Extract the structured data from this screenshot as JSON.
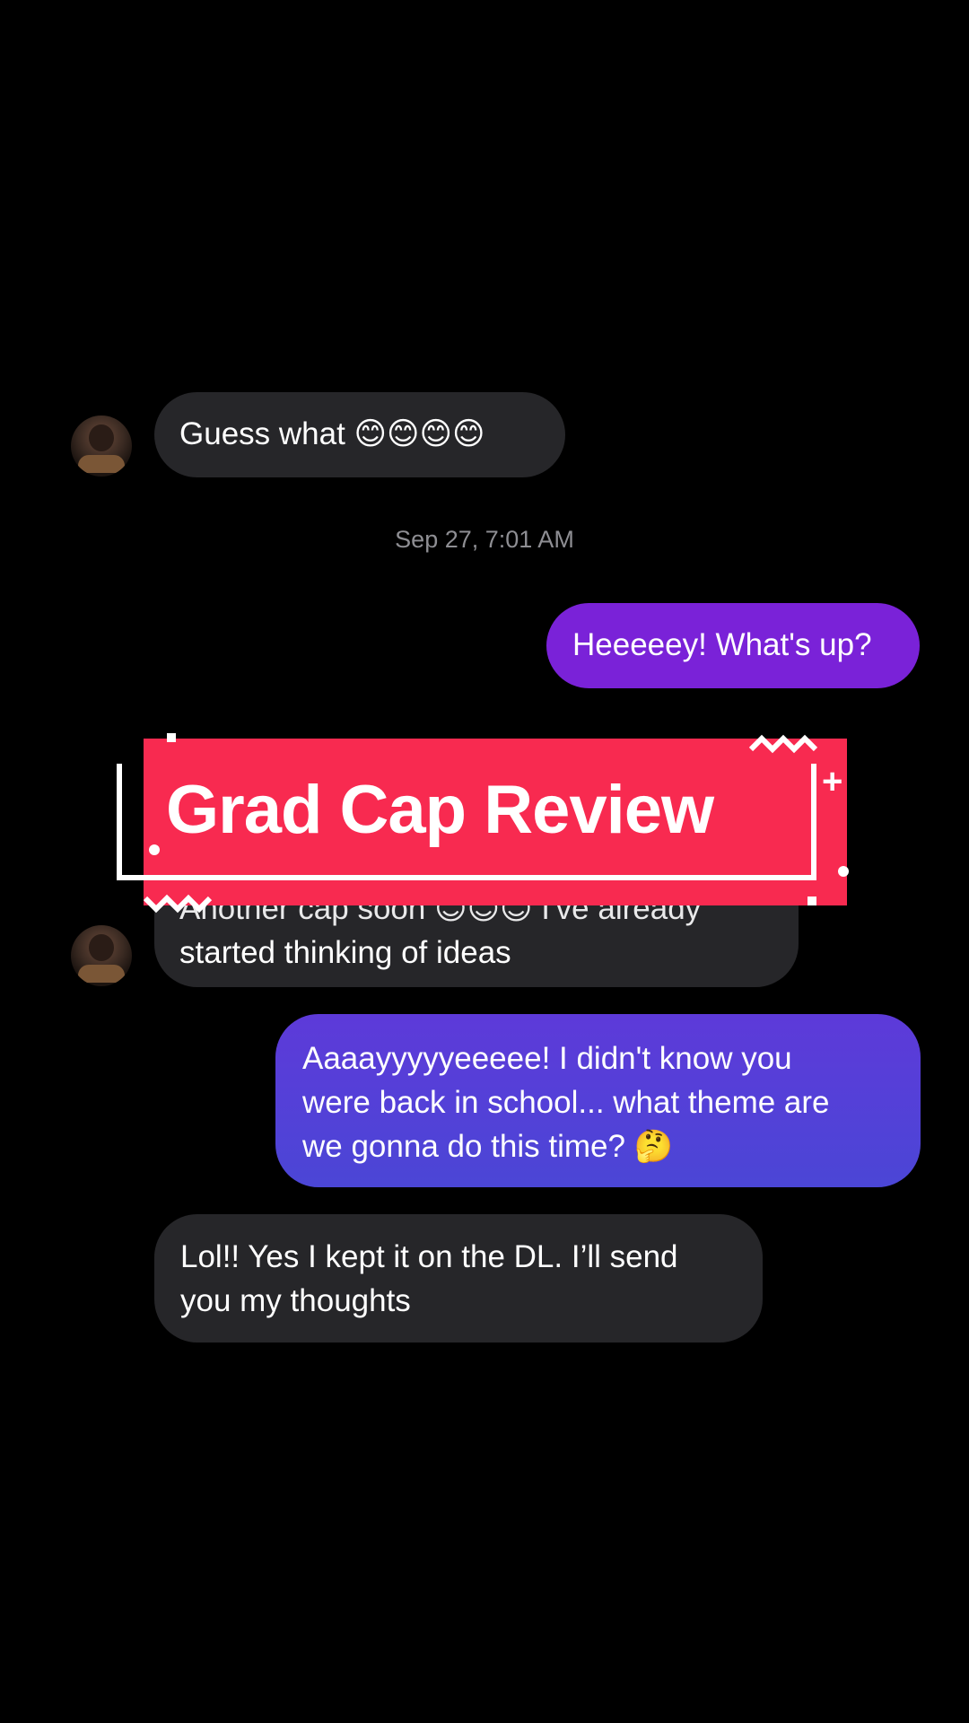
{
  "messages": [
    {
      "from": "them",
      "text": "Guess what 😊😊😊😊"
    },
    {
      "from": "meta",
      "text": "Sep 27, 7:01 AM"
    },
    {
      "from": "me",
      "text": "Heeeeey! What's up?"
    },
    {
      "from": "them",
      "lines": [
        "Another cap soon 😊😊😊 I've already",
        "started thinking of ideas"
      ]
    },
    {
      "from": "me",
      "lines": [
        "Aaaayyyyyeeeee! I didn't know you",
        "were back in school... what theme are",
        "we gonna do this time? 🤔"
      ]
    },
    {
      "from": "them",
      "lines": [
        "Lol!! Yes I kept it on the DL. I’ll send",
        "you my thoughts"
      ]
    }
  ],
  "overlay": {
    "title": "Grad Cap Review"
  },
  "colors": {
    "background": "#000000",
    "incoming_bubble": "#262629",
    "outgoing_gradient_top": "#7b20d8",
    "outgoing_gradient_bottom": "#4b46d6",
    "title_red": "#f82a50",
    "timestamp": "#8e8e93"
  }
}
